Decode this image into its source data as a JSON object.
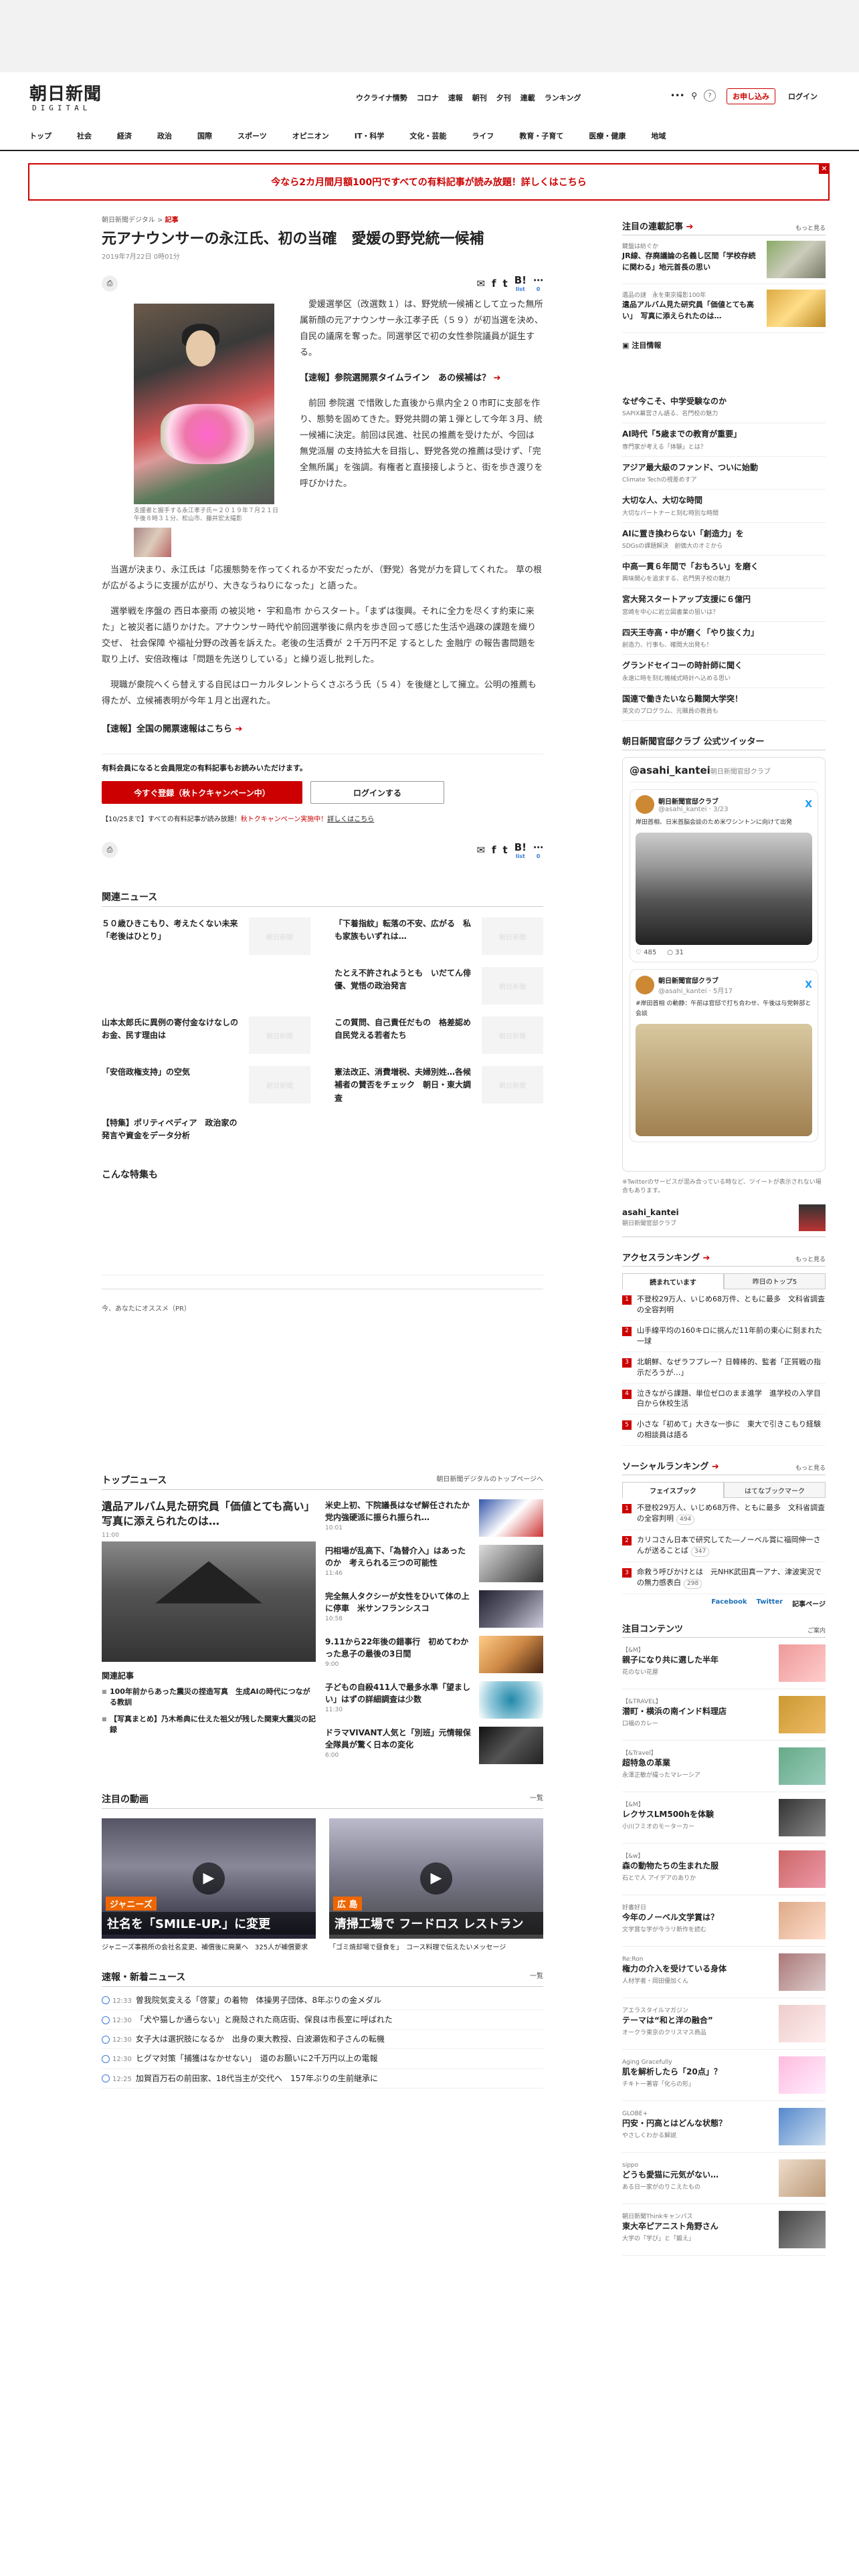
{
  "header": {
    "logo_main": "朝日新聞",
    "logo_sub": "DIGITAL",
    "links": [
      "ウクライナ情勢",
      "コロナ",
      "速報",
      "朝刊",
      "夕刊",
      "連載",
      "ランキング"
    ],
    "more": "•••",
    "help": "?",
    "register": "お申し込み",
    "login": "ログイン"
  },
  "nav": [
    "トップ",
    "社会",
    "経済",
    "政治",
    "国際",
    "スポーツ",
    "オピニオン",
    "IT・科学",
    "文化・芸能",
    "ライフ",
    "教育・子育て",
    "医療・健康",
    "地域"
  ],
  "banner": {
    "text": "今なら2カ月間月額100円ですべての有料記事が読み放題！詳しくはこちら",
    "close": "×"
  },
  "article": {
    "crumb_site": "朝日新聞デジタル",
    "crumb_sep": ">",
    "crumb_cat": "記事",
    "title": "元アナウンサーの永江氏、初の当確　愛媛の野党統一候補",
    "date": "2019年7月22日 0時01分",
    "print": "⎙",
    "share_count": "list",
    "share_count2": "0",
    "caption": "支援者と握手する永江孝子氏＝２０１９年７月２１日午後８時３１分、松山市、藤井宏太撮影",
    "p1": "愛媛選挙区（改選数１）は、野党統一候補として立った無所属新顔の元アナウンサー永江孝子氏（５９）が初当選を決め、自民の議席を奪った。同選挙区で初の女性参院議員が誕生する。",
    "link1": "【速報】参院選開票タイムライン　あの候補は？",
    "p2": "前回 参院選 で惜敗した直後から県内全２０市町に支部を作り、態勢を固めてきた。野党共闘の第１弾として今年３月、統一候補に決定。前回は民進、社民の推薦を受けたが、今回は 無党派層 の支持拡大を目指し、野党各党の推薦は受けず、「完全無所属」を強調。有権者と直接接しようと、街を歩き渡りを呼びかけた。",
    "p3": "当選が決まり、永江氏は「応援態勢を作ってくれるか不安だったが、（野党）各党が力を貸してくれた。 草の根 が広がるように支援が広がり、大きなうねりになった」と語った。",
    "p4": "選挙戦を序盤の 西日本豪雨 の被災地・ 宇和島市 からスタート。「まずは復興。それに全力を尽くす約束に来た」と被災者に語りかけた。アナウンサー時代や前回選挙後に県内を歩き回って感じた生活や過疎の課題を織り交ぜ、 社会保障 や福祉分野の改善を訴えた。老後の生活費が ２千万円不足 するとした 金融庁 の報告書問題を取り上げ、安倍政権は「問題を先送りしている」と繰り返し批判した。",
    "p5": "現職が衆院へくら替えする自民はローカルタレントらくさぶろう氏（５４）を後継として擁立。公明の推薦も得たが、立候補表明が今年１月と出遅れた。",
    "link2": "【速報】全国の開票速報はこちら",
    "member_text": "有料会員になると会員限定の有料記事もお読みいただけます。",
    "btn_register": "今すぐ登録（秋トクキャンペーン中）",
    "btn_login": "ログインする",
    "camp_pre": "【10/25まで】すべての有料記事が読み放題！",
    "camp_red": "秋トクキャンペーン実施中！",
    "camp_post": "詳しくはこちら"
  },
  "related": {
    "title": "関連ニュース",
    "items": [
      "５０歳ひきこもり、考えたくない未来　「老後はひとり」",
      "「下着指紋」転落の不安、広がる　私も家族もいずれは…",
      "",
      "たとえ不許されようとも　いだてん俳優、覚悟の政治発言",
      "山本太郎氏に異例の寄付金なけなしのお金、民す理由は",
      "この質問、自己責任だもの　格差認め自民党える若者たち",
      "「安倍政権支持」の空気",
      "憲法改正、消費増税、夫婦別姓…各候補者の賛否をチェック　朝日・東大調査",
      "【特集】ポリティペディア　政治家の発言や資金をデータ分析",
      ""
    ],
    "ph": "朝日新聞"
  },
  "special": {
    "title": "こんな特集も"
  },
  "pr": {
    "text": "今、あなたにオススメ（PR）"
  },
  "topnews": {
    "title": "トップニュース",
    "more": "朝日新聞デジタルのトップページへ",
    "main_title": "遺品アルバム見た研究員「価値とても高い」　写真に添えられたのは…",
    "main_time": "11:00",
    "rel_title": "関連記事",
    "rel": [
      "100年前からあった震災の捏造写真　生成AIの時代につながる教訓",
      "【写真まとめ】乃木希典に仕えた祖父が残した関東大震災の記録"
    ],
    "items": [
      {
        "t": "米史上初、下院議長はなぜ解任されたか　党内強硬派に振られ振られ…",
        "tm": "10:01"
      },
      {
        "t": "円相場が乱高下、「為替介入」はあったのか　考えられる三つの可能性",
        "tm": "11:46"
      },
      {
        "t": "完全無人タクシーが女性をひいて体の上に停車　米サンフランシスコ",
        "tm": "10:58"
      },
      {
        "t": "9.11から22年後の錯事行　初めてわかった息子の最後の3日間",
        "tm": "9:00"
      },
      {
        "t": "子どもの自殺411人で最多水準「望ましい」はずの詳細調査は少数",
        "tm": "11:30"
      },
      {
        "t": "ドラマVIVANT人気と「別班」元情報保全隊員が驚く日本の変化",
        "tm": "6:00"
      }
    ]
  },
  "videos": {
    "title": "注目の動画",
    "more": "一覧",
    "items": [
      {
        "tag": "ジャニーズ",
        "bar": "社名を「SMILE-UP.」に変更",
        "cap": "ジャニーズ事務所の会社名変更、補償後に廃業へ　325人が補償要求"
      },
      {
        "tag": "広 島",
        "bar": "清掃工場で フードロス レストラン",
        "cap": "「ゴミ焼却場で昼食を」　コース料理で伝えたいメッセージ"
      }
    ]
  },
  "breaking": {
    "title": "速報・新着ニュース",
    "more": "一覧",
    "items": [
      {
        "tm": "12:33",
        "t": "曽我院気変える「啓蒙」の着物　体操男子団体、8年ぶりの金メダル"
      },
      {
        "tm": "12:30",
        "t": "「犬や猫しか通らない」と廃殻された商店街、保良は市長室に呼ばれた"
      },
      {
        "tm": "12:30",
        "t": "女子大は選択肢になるか　出身の東大教授、白波瀬佐和子さんの転機"
      },
      {
        "tm": "12:30",
        "t": "ヒグマ対策「捕獲はなかせない」　道のお願いに2千万円以上の電報"
      },
      {
        "tm": "12:25",
        "t": "加賀百万石の前田家、18代当主が交代へ　157年ぶりの生前継承に"
      }
    ]
  },
  "side": {
    "related_title": "注目の連載記事",
    "more": "もっと見る",
    "pick": [
      {
        "s": "鍵盤は紡ぐか",
        "t": "JR線、存廃議論の名義し区間「学校存続に関わる」地元首長の思い"
      },
      {
        "s": "遺品の謎　永を東京撮影100年",
        "t": "遺品アルバム見た研究員「価値とても高い」　写真に添えられたのは…"
      }
    ],
    "chui": "注目情報",
    "list": [
      {
        "t": "なぜ今こそ、中学受験なのか",
        "s": "SAPIX幕営さん語る、名門校の魅力"
      },
      {
        "t": "AI時代「5歳までの教育が重要」",
        "s": "専門家が考える「体験」とは？"
      },
      {
        "t": "アジア最大級のファンド、ついに始動",
        "s": "Climate Techの視差めすア"
      },
      {
        "t": "大切な人、大切な時間",
        "s": "大切なパートナーと刻む時別な時間"
      },
      {
        "t": "AIに置き換わらない「創造力」を",
        "s": "SDGsの課題解決　創価大のオミから"
      },
      {
        "t": "中高一貫６年間で「おもろい」を磨く",
        "s": "興味関心を追求する、名門男子校の魅力"
      },
      {
        "t": "宮大発スタートアップ支援に６億円",
        "s": "宮崎を中心に岩立図書業の狙いは？"
      },
      {
        "t": "四天王寺高・中が磨く「やり抜く力」",
        "s": "創造力、行事も、確間大出発も！"
      },
      {
        "t": "グランドセイコーの時計師に聞く",
        "s": "永遠に時を刻む機械式時計へ込める思い"
      },
      {
        "t": "国連で働きたいなら難関大学突！",
        "s": "英文のプログラム、元職員の教員も"
      }
    ],
    "tw_title": "朝日新聞官邸クラブ 公式ツイッター",
    "tw_handle_head": "@asahi_kantei",
    "tw_handle_tail": "朝日新聞官邸クラブ",
    "tweets": [
      {
        "n": "朝日新聞官邸クラブ",
        "h": "@asahi_kantei · 3/23",
        "b": "岸田首相、日米首脳会談のため米ワシントンに向けて出発"
      },
      {
        "n": "朝日新聞官邸クラブ",
        "h": "@asahi_kantei · 5月17",
        "b": "#岸田首相 の動静：午前は官邸で打ち合わせ、午後は与党幹部と会談"
      }
    ],
    "tw_like": "♡ 485",
    "tw_reply": "○ 31",
    "tw_note": "※Twitterのサービスが混み合っている時など、ツイートが表示されない場合もあります。",
    "acct_name": "asahi_kantei",
    "acct_sub": "朝日新聞官邸クラブ",
    "access_title": "アクセスランキング",
    "tab1": "読まれています",
    "tab2": "昨日のトップ5",
    "access": [
      "不登校29万人、いじめ68万件、ともに最多　文科省調査の全容判明",
      "山手線平均の160キロに挑んだ11年前の東心に刻まれた一球",
      "北朝鮮、なぜラフプレー？日韓棒的、監者「正質戦の指示だろうが…」",
      "泣きながら課題、単位ゼロのまま進学　進学校の入学目白から休校生活",
      "小さな「初めて」大きな一歩に　東大で引きこもり経験の相談員は語る"
    ],
    "social_title": "ソーシャルランキング",
    "stab1": "フェイスブック",
    "stab2": "はてなブックマーク",
    "social": [
      {
        "t": "不登校29万人、いじめ68万件、ともに最多　文科省調査の全容判明",
        "c": "494"
      },
      {
        "t": "カリコさん日本で研究してた―ノーベル賞に福岡伸一さんが送ることば",
        "c": "347"
      },
      {
        "t": "命救う呼びかけとは　元NHK武田真一アナ、津波実況での無力感表白",
        "c": "298"
      }
    ],
    "fb": "Facebook",
    "tw": "Twitter",
    "bm": "記事ページ",
    "cont_title": "注目コンテンツ",
    "cont_more": "ご案内",
    "cont": [
      {
        "tg": "【&M】",
        "t": "親子になり共に選した半年",
        "s": "花のない花屋"
      },
      {
        "tg": "【&TRAVEL】",
        "t": "潜町・横浜の南インド料理店",
        "s": "口福のカレー"
      },
      {
        "tg": "【&Travel】",
        "t": "超特急の革業",
        "s": "永澤正敏が撮ったマレーシア"
      },
      {
        "tg": "【&M】",
        "t": "レクサスLM500hを体験",
        "s": "小川フミオのモーターカー"
      },
      {
        "tg": "【&w】",
        "t": "森の動物たちの生まれた服",
        "s": "石とで人 アイデアのありか"
      },
      {
        "tg": "好書好日",
        "t": "今年のノーベル文学賞は？",
        "s": "文学賞な学が今ラリ新作を読む"
      },
      {
        "tg": "Re:Ron",
        "t": "権力の介入を受けている身体",
        "s": "人材学者・岡田優加くん"
      },
      {
        "tg": "アエラスタイルマガジン",
        "t": "テーマは“和と洋の融合”",
        "s": "オークラ東京のクリスマス商品"
      },
      {
        "tg": "Aging Gracefully",
        "t": "肌を解析したら「20点」？",
        "s": "チキトー著容「化らの形」"
      },
      {
        "tg": "GLOBE+",
        "t": "円安・円高とはどんな状態？",
        "s": "やさしくわかる解説"
      },
      {
        "tg": "sippo",
        "t": "どうも愛猫に元気がない…",
        "s": "ある日一家がのりこえたもの"
      },
      {
        "tg": "朝日新聞Thinkキャンパス",
        "t": "東大卒ピアニスト角野さん",
        "s": "大学の「学び」と「鍛え」"
      }
    ]
  }
}
